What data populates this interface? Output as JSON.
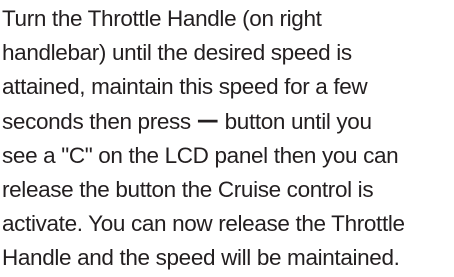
{
  "instruction": {
    "line1": "Turn the Throttle Handle (on right",
    "line2": "handlebar) until the desired speed is",
    "line3": "attained, maintain this speed for a few",
    "line4_before": "seconds then press ",
    "minus_symbol": "—",
    "line4_after": " button until you",
    "line5": "see a \"C\" on the LCD panel then you can",
    "line6": "release the button the Cruise control is",
    "line7": "activate. You can now release the Throttle",
    "line8": "Handle and the speed will be maintained."
  }
}
